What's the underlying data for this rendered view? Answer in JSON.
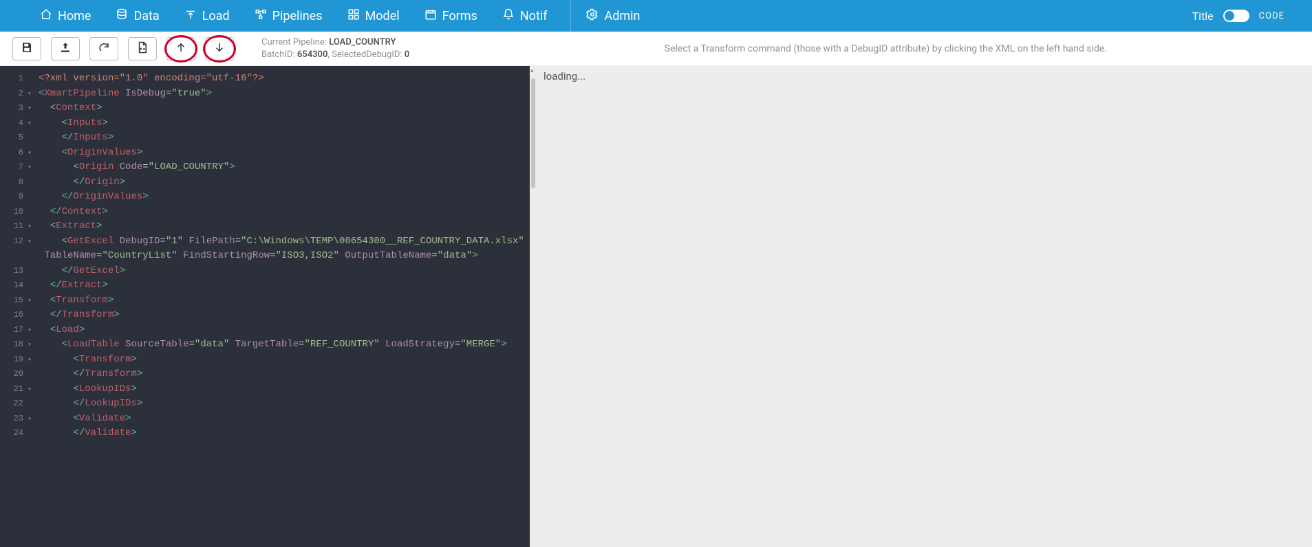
{
  "nav": {
    "items": [
      {
        "label": "Home",
        "icon": "home"
      },
      {
        "label": "Data",
        "icon": "database"
      },
      {
        "label": "Load",
        "icon": "upload-alt"
      },
      {
        "label": "Pipelines",
        "icon": "pipeline"
      },
      {
        "label": "Model",
        "icon": "model"
      },
      {
        "label": "Forms",
        "icon": "calendar"
      },
      {
        "label": "Notif",
        "icon": "bell"
      }
    ],
    "admin_label": "Admin",
    "title_label": "Title",
    "code_label": "CODE"
  },
  "toolbar": {
    "current_pipeline_label": "Current Pipeline:",
    "current_pipeline_value": "LOAD_COUNTRY",
    "batch_label": "BatchID:",
    "batch_value": "654300",
    "selected_debug_label": "SelectedDebugID:",
    "selected_debug_value": "0",
    "hint": "Select a Transform command (those with a DebugID attribute) by clicking the XML on the left hand side."
  },
  "right_panel": {
    "loading_text": "loading..."
  },
  "code": {
    "lines": [
      {
        "n": 1,
        "fold": false,
        "indent": 0,
        "raw": "<?xml version=\"1.0\" encoding=\"utf-16\"?>",
        "type": "decl"
      },
      {
        "n": 2,
        "fold": true,
        "indent": 0,
        "tag": "XmartPipeline",
        "attrs": [
          [
            "IsDebug",
            "true"
          ]
        ],
        "open": true
      },
      {
        "n": 3,
        "fold": true,
        "indent": 1,
        "tag": "Context",
        "open": true
      },
      {
        "n": 4,
        "fold": true,
        "indent": 2,
        "tag": "Inputs",
        "open": true
      },
      {
        "n": 5,
        "fold": false,
        "indent": 2,
        "tag": "Inputs",
        "close": true
      },
      {
        "n": 6,
        "fold": true,
        "indent": 2,
        "tag": "OriginValues",
        "open": true
      },
      {
        "n": 7,
        "fold": true,
        "indent": 3,
        "tag": "Origin",
        "attrs": [
          [
            "Code",
            "LOAD_COUNTRY"
          ]
        ],
        "open": true
      },
      {
        "n": 8,
        "fold": false,
        "indent": 3,
        "tag": "Origin",
        "close": true
      },
      {
        "n": 9,
        "fold": false,
        "indent": 2,
        "tag": "OriginValues",
        "close": true
      },
      {
        "n": 10,
        "fold": false,
        "indent": 1,
        "tag": "Context",
        "close": true
      },
      {
        "n": 11,
        "fold": true,
        "indent": 1,
        "tag": "Extract",
        "open": true
      },
      {
        "n": 12,
        "fold": true,
        "indent": 2,
        "tag": "GetExcel",
        "attrs": [
          [
            "DebugID",
            "1"
          ],
          [
            "FilePath",
            "C:\\Windows\\TEMP\\00654300__REF_COUNTRY_DATA.xlsx"
          ]
        ],
        "open": true,
        "no_close_bracket": true
      },
      {
        "n": 0,
        "fold": false,
        "indent": 0,
        "cont": true,
        "attrs": [
          [
            "TableName",
            "CountryList"
          ],
          [
            "FindStartingRow",
            "ISO3,ISO2"
          ],
          [
            "OutputTableName",
            "data"
          ]
        ],
        "end_bracket": true
      },
      {
        "n": 13,
        "fold": false,
        "indent": 2,
        "tag": "GetExcel",
        "close": true
      },
      {
        "n": 14,
        "fold": false,
        "indent": 1,
        "tag": "Extract",
        "close": true
      },
      {
        "n": 15,
        "fold": true,
        "indent": 1,
        "tag": "Transform",
        "open": true
      },
      {
        "n": 16,
        "fold": false,
        "indent": 1,
        "tag": "Transform",
        "close": true
      },
      {
        "n": 17,
        "fold": true,
        "indent": 1,
        "tag": "Load",
        "open": true
      },
      {
        "n": 18,
        "fold": true,
        "indent": 2,
        "tag": "LoadTable",
        "attrs": [
          [
            "SourceTable",
            "data"
          ],
          [
            "TargetTable",
            "REF_COUNTRY"
          ],
          [
            "LoadStrategy",
            "MERGE"
          ]
        ],
        "open": true
      },
      {
        "n": 19,
        "fold": true,
        "indent": 3,
        "tag": "Transform",
        "open": true
      },
      {
        "n": 20,
        "fold": false,
        "indent": 3,
        "tag": "Transform",
        "close": true
      },
      {
        "n": 21,
        "fold": true,
        "indent": 3,
        "tag": "LookupIDs",
        "open": true
      },
      {
        "n": 22,
        "fold": false,
        "indent": 3,
        "tag": "LookupIDs",
        "close": true
      },
      {
        "n": 23,
        "fold": true,
        "indent": 3,
        "tag": "Validate",
        "open": true
      },
      {
        "n": 24,
        "fold": false,
        "indent": 3,
        "tag": "Validate",
        "close": true
      }
    ]
  }
}
